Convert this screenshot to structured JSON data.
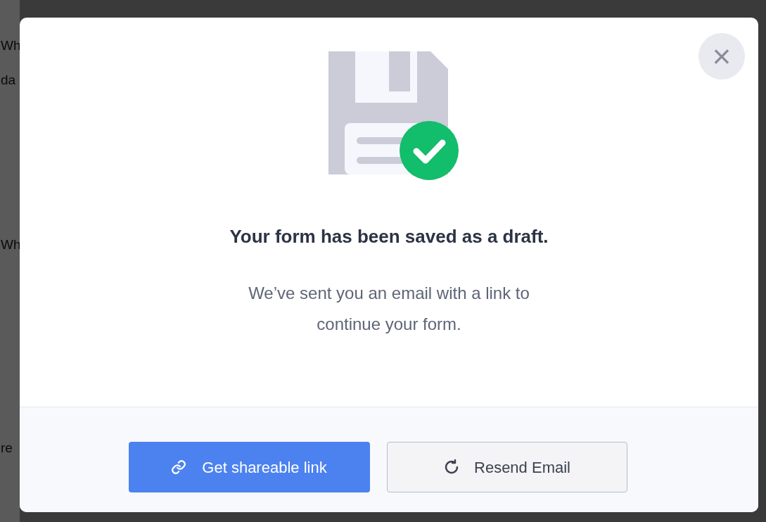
{
  "background_fragments": [
    {
      "text": "Wh"
    },
    {
      "text": "da"
    },
    {
      "text": "Wh"
    },
    {
      "text": "re"
    }
  ],
  "dialog": {
    "close_label": "×",
    "title": "Your form has been saved as a draft.",
    "message_lines": [
      "We’ve sent you an email with a link to",
      "continue your form."
    ],
    "buttons": [
      {
        "kind": "primary",
        "label": "Get shareable link"
      },
      {
        "kind": "secondary",
        "label": "Resend Email"
      }
    ]
  }
}
